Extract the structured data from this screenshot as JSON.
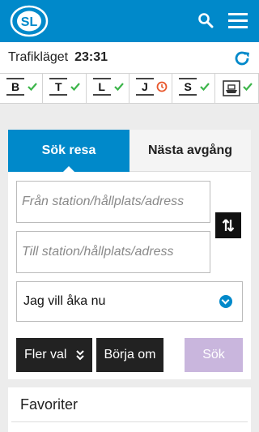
{
  "header": {
    "logo_text": "SL",
    "search_icon": "search-icon",
    "menu_icon": "hamburger-menu-icon",
    "background_color": "#0089ca"
  },
  "traffic": {
    "label": "Trafikläget",
    "time": "23:31",
    "refresh_icon": "refresh-icon"
  },
  "modes": [
    {
      "letter": "B",
      "status": "ok"
    },
    {
      "letter": "T",
      "status": "ok"
    },
    {
      "letter": "L",
      "status": "ok"
    },
    {
      "letter": "J",
      "status": "delay"
    },
    {
      "letter": "S",
      "status": "ok"
    },
    {
      "letter": "",
      "status": "ok",
      "icon": "ferry-icon"
    }
  ],
  "status_colors": {
    "ok": "#3cb54a",
    "delay": "#e8562a"
  },
  "planner": {
    "tabs": [
      {
        "label": "Sök resa",
        "active": true
      },
      {
        "label": "Nästa avgång",
        "active": false
      }
    ],
    "from_placeholder": "Från station/hållplats/adress",
    "to_placeholder": "Till station/hållplats/adress",
    "time_option": "Jag vill åka nu",
    "more_label": "Fler val",
    "reset_label": "Börja om",
    "search_label": "Sök",
    "search_button_color": "#c9b6dd"
  },
  "favorites": {
    "title": "Favoriter"
  }
}
